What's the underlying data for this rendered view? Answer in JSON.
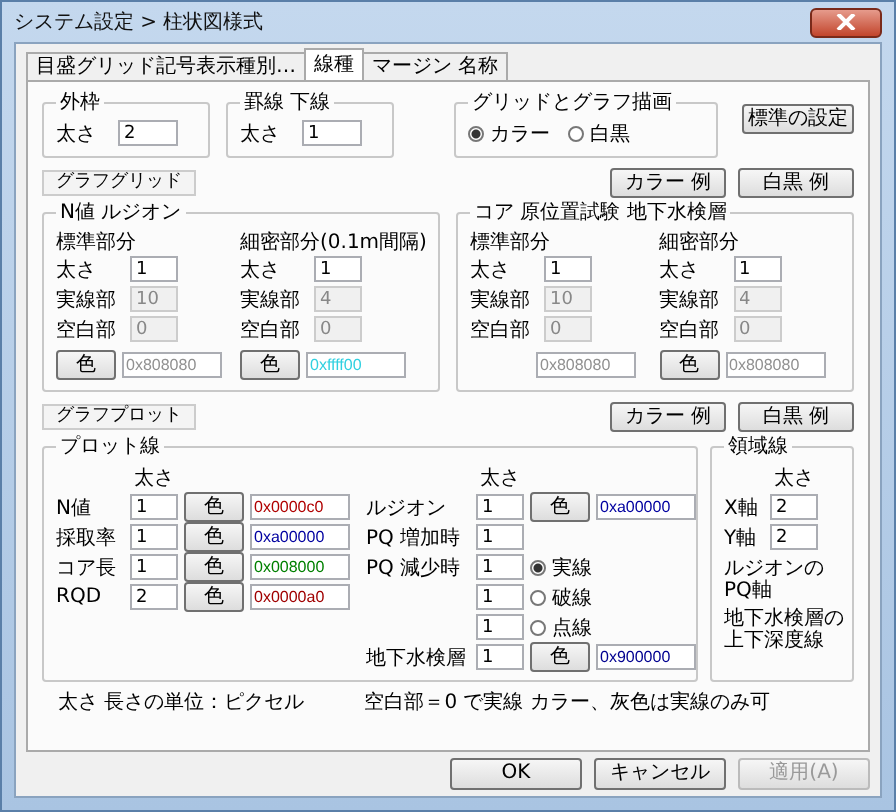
{
  "window": {
    "title": "システム設定 > 柱状図様式"
  },
  "tabs": [
    {
      "label": "目盛グリッド記号表示種別…",
      "selected": false
    },
    {
      "label": "線種",
      "selected": true
    },
    {
      "label": "マージン 名称",
      "selected": false
    }
  ],
  "outer_frame": {
    "title": "外枠",
    "label": "太さ",
    "value": "2"
  },
  "ruled_line": {
    "title": "罫線 下線",
    "label": "太さ",
    "value": "1"
  },
  "drawing_mode": {
    "title": "グリッドとグラフ描画",
    "options": [
      {
        "label": "カラー",
        "selected": true
      },
      {
        "label": "白黒",
        "selected": false
      }
    ]
  },
  "default_button": "標準の設定",
  "graph_grid": {
    "label": "グラフグリッド",
    "buttons": [
      "カラー 例",
      "白黒 例"
    ],
    "groups": [
      {
        "title": "N値 ルジオン",
        "columns": [
          {
            "heading": "標準部分",
            "rows": [
              {
                "label": "太さ",
                "value": "1",
                "disabled": false
              },
              {
                "label": "実線部",
                "value": "10",
                "disabled": true
              },
              {
                "label": "空白部",
                "value": "0",
                "disabled": true
              }
            ],
            "button": "色",
            "color_value": "0x808080",
            "color": "#909090"
          },
          {
            "heading": "細密部分(0.1m間隔)",
            "rows": [
              {
                "label": "太さ",
                "value": "1",
                "disabled": false
              },
              {
                "label": "実線部",
                "value": "4",
                "disabled": true
              },
              {
                "label": "空白部",
                "value": "0",
                "disabled": true
              }
            ],
            "button": "色",
            "color_value": "0xffff00",
            "color": "#30d0e0"
          }
        ]
      },
      {
        "title": "コア 原位置試験 地下水検層",
        "columns": [
          {
            "heading": "標準部分",
            "rows": [
              {
                "label": "太さ",
                "value": "1",
                "disabled": false
              },
              {
                "label": "実線部",
                "value": "10",
                "disabled": true
              },
              {
                "label": "空白部",
                "value": "0",
                "disabled": true
              }
            ],
            "color_value": "0x808080",
            "color": "#909090"
          },
          {
            "heading": "細密部分",
            "rows": [
              {
                "label": "太さ",
                "value": "1",
                "disabled": false
              },
              {
                "label": "実線部",
                "value": "4",
                "disabled": true
              },
              {
                "label": "空白部",
                "value": "0",
                "disabled": true
              }
            ],
            "button": "色",
            "color_value": "0x808080",
            "color": "#909090"
          }
        ]
      }
    ]
  },
  "graph_plot": {
    "label": "グラフプロット",
    "buttons": [
      "カラー 例",
      "白黒 例"
    ],
    "plot_lines": {
      "title": "プロット線",
      "left": {
        "heading": "太さ",
        "rows": [
          {
            "kind": "color_row",
            "label": "N値",
            "value": "1",
            "button": "色",
            "color_value": "0x0000c0",
            "color": "#b00000"
          },
          {
            "kind": "color_row",
            "label": "採取率",
            "value": "1",
            "button": "色",
            "color_value": "0xa00000",
            "color": "#0000a0"
          },
          {
            "kind": "color_row",
            "label": "コア長",
            "value": "1",
            "button": "色",
            "color_value": "0x008000",
            "color": "#008000"
          },
          {
            "kind": "color_row",
            "label": "RQD",
            "value": "2",
            "button": "色",
            "color_value": "0x0000a0",
            "color": "#a00000"
          }
        ]
      },
      "right": {
        "heading": "太さ",
        "rows": [
          {
            "kind": "color_row",
            "label": "ルジオン",
            "value": "1",
            "button": "色",
            "color_value": "0xa00000",
            "color": "#0000a0"
          },
          {
            "kind": "width_row",
            "label": "PQ 増加時",
            "value": "1"
          },
          {
            "kind": "radio_row",
            "label": "PQ 減少時",
            "value": "1",
            "option": "実線",
            "selected": true
          },
          {
            "kind": "radio_row",
            "value": "1",
            "option": "破線",
            "selected": false
          },
          {
            "kind": "radio_row",
            "value": "1",
            "option": "点線",
            "selected": false
          },
          {
            "kind": "color_row",
            "label": "地下水検層",
            "value": "1",
            "button": "色",
            "color_value": "0x900000",
            "color": "#000090"
          }
        ]
      }
    },
    "region_lines": {
      "title": "領域線",
      "heading": "太さ",
      "rows": [
        {
          "label": "X軸",
          "value": "2"
        },
        {
          "label": "Y軸",
          "value": "2"
        }
      ],
      "notes": [
        {
          "lines": [
            "ルジオンの",
            "PQ軸"
          ]
        },
        {
          "lines": [
            "地下水検層の",
            "上下深度線"
          ]
        }
      ]
    }
  },
  "notes": [
    "太さ 長さの単位：ピクセル",
    "空白部＝0 で実線 カラー、灰色は実線のみ可"
  ],
  "buttons": [
    {
      "label": "OK",
      "disabled": false
    },
    {
      "label": "キャンセル",
      "disabled": false
    },
    {
      "label": "適用(A)",
      "disabled": true
    }
  ]
}
